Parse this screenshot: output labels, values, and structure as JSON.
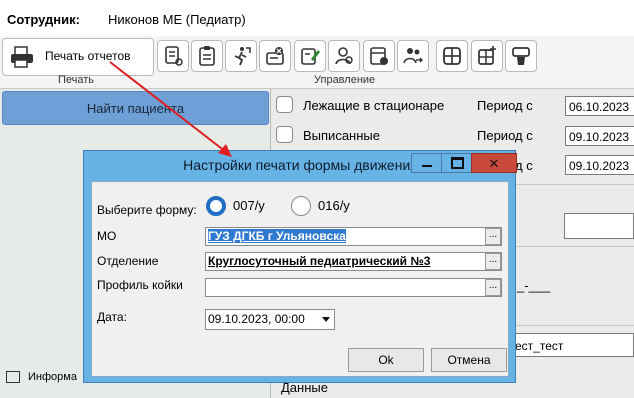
{
  "header": {
    "employee_label": "Сотрудник:",
    "employee_name": "Никонов МЕ (Педиатр)"
  },
  "toolbar": {
    "print_button_label": "Печать отчетов",
    "group_print_label": "Печать",
    "group_manage_label": "Управление",
    "icons": [
      "report-icon",
      "clipboard-icon",
      "discharge-icon",
      "clear-bed-icon",
      "edit-doc-icon",
      "user-search-icon",
      "register-icon",
      "transfer-patient-icon",
      "grid-icon",
      "add-grid-icon",
      "delete-grid-icon"
    ]
  },
  "left": {
    "find_patient_label": "Найти пациента",
    "info_label": "Информа"
  },
  "right": {
    "inpatient_label": "Лежащие в стационаре",
    "discharged_label": "Выписанные",
    "period_label": "Период с",
    "period_date_1": "06.10.2023",
    "period_date_2": "09.10.2023",
    "period_date_3": "09.10.2023",
    "placeholder_dashes": "_-___",
    "test_text": "ест_тест",
    "data_label": "Данные"
  },
  "dialog": {
    "title": "Настройки печати формы движения",
    "choose_form_label": "Выберите форму:",
    "form_007": "007/у",
    "form_016": "016/у",
    "mo_label": "МО",
    "mo_value": "ГУЗ ДГКБ г Ульяновска",
    "department_label": "Отделение",
    "department_value": "Круглосуточный педиатрический №3",
    "bed_profile_label": "Профиль койки",
    "bed_profile_value": "",
    "date_label": "Дата:",
    "date_value": "09.10.2023, 00:00",
    "ellipsis": "...",
    "ok_label": "Ok",
    "cancel_label": "Отмена"
  },
  "colors": {
    "dialog_frame": "#68b3e6",
    "find_button": "#6e9fd6",
    "close_button": "#c94a3a",
    "arrow": "#e02020",
    "selected_radio": "#1d6fc2"
  }
}
